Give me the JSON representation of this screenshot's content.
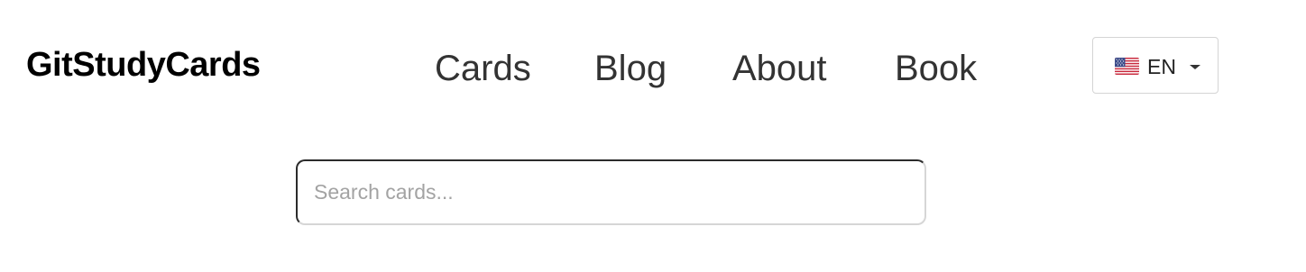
{
  "brand": {
    "name": "GitStudyCards"
  },
  "nav": {
    "items": [
      {
        "label": "Cards"
      },
      {
        "label": "Blog"
      },
      {
        "label": "About"
      },
      {
        "label": "Book"
      }
    ]
  },
  "language": {
    "selected": "EN",
    "flag_icon": "us-flag-icon"
  },
  "search": {
    "value": "",
    "placeholder": "Search cards..."
  },
  "colors": {
    "text": "#333333",
    "brand": "#000000",
    "border": "#d6d6d6",
    "placeholder": "#a3a3a3"
  }
}
